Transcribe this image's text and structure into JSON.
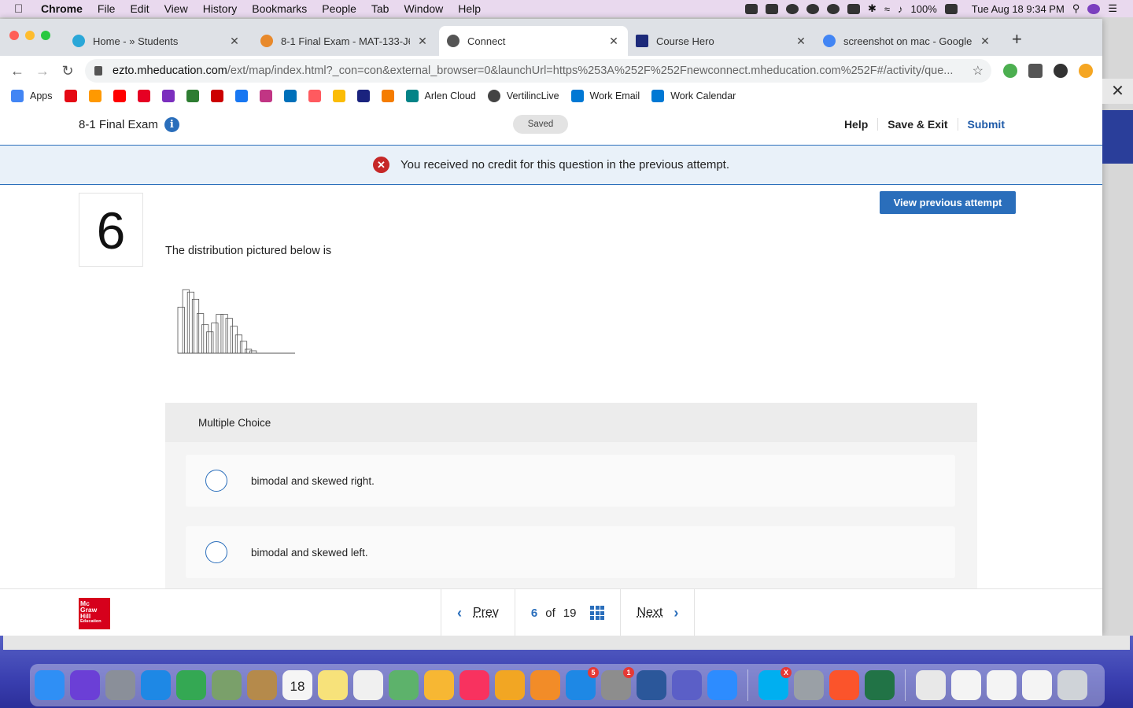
{
  "menubar": {
    "app": "Chrome",
    "items": [
      "File",
      "Edit",
      "View",
      "History",
      "Bookmarks",
      "People",
      "Tab",
      "Window",
      "Help"
    ],
    "battery": "100%",
    "clock": "Tue Aug 18  9:34 PM"
  },
  "browser": {
    "tabs": [
      {
        "label": "Home - » Students",
        "icon_color": "#2aa7d8"
      },
      {
        "label": "8-1 Final Exam - MAT-133-J68",
        "icon_color": "#e8892b"
      },
      {
        "label": "Connect",
        "icon_color": "#555555"
      },
      {
        "label": "Course Hero",
        "icon_color": "#1d2a7a"
      },
      {
        "label": "screenshot on mac - Google S",
        "icon_color": "#4285f4"
      }
    ],
    "url_host": "ezto.mheducation.com",
    "url_path": "/ext/map/index.html?_con=con&external_browser=0&launchUrl=https%253A%252F%252Fnewconnect.mheducation.com%252F#/activity/que...",
    "bookmarks": [
      {
        "label": "Apps",
        "color": "#4285f4"
      },
      {
        "label": "",
        "color": "#e50914"
      },
      {
        "label": "",
        "color": "#ff9900"
      },
      {
        "label": "",
        "color": "#ff0000"
      },
      {
        "label": "",
        "color": "#e60023"
      },
      {
        "label": "",
        "color": "#7b2fbe"
      },
      {
        "label": "",
        "color": "#2e7d32"
      },
      {
        "label": "",
        "color": "#cc0000"
      },
      {
        "label": "",
        "color": "#1877f2"
      },
      {
        "label": "",
        "color": "#c13584"
      },
      {
        "label": "",
        "color": "#0070ba"
      },
      {
        "label": "",
        "color": "#ff5a5f"
      },
      {
        "label": "",
        "color": "#fbbc05"
      },
      {
        "label": "",
        "color": "#1a237e"
      },
      {
        "label": "",
        "color": "#f57c00"
      },
      {
        "label": "Arlen Cloud",
        "color": "#038387"
      },
      {
        "label": "VertilincLive",
        "color": "#444444"
      },
      {
        "label": "Work Email",
        "color": "#0078d4"
      },
      {
        "label": "Work Calendar",
        "color": "#0078d4"
      }
    ]
  },
  "exam": {
    "title": "8-1 Final Exam",
    "saved": "Saved",
    "help": "Help",
    "save_exit": "Save & Exit",
    "submit": "Submit",
    "banner": "You received no credit for this question in the previous attempt.",
    "question_number": "6",
    "view_previous": "View previous attempt",
    "question_text": "The distribution pictured below is",
    "answer_type": "Multiple Choice",
    "options": [
      "bimodal and skewed right.",
      "bimodal and skewed left."
    ],
    "histogram_relative_heights": [
      0.58,
      0.8,
      0.77,
      0.68,
      0.5,
      0.36,
      0.27,
      0.38,
      0.49,
      0.49,
      0.44,
      0.34,
      0.23,
      0.15,
      0.05,
      0.03
    ]
  },
  "footer": {
    "logo_lines": [
      "Mc",
      "Graw",
      "Hill",
      "Education"
    ],
    "prev": "Prev",
    "current": "6",
    "of": "of",
    "total": "19",
    "next": "Next"
  },
  "dock": {
    "icons": [
      {
        "name": "finder",
        "color": "#2f8ff5"
      },
      {
        "name": "siri",
        "color": "#6b3fd6"
      },
      {
        "name": "launchpad",
        "color": "#8a8f99"
      },
      {
        "name": "safari",
        "color": "#1e88e5"
      },
      {
        "name": "chrome",
        "color": "#34a853"
      },
      {
        "name": "preview",
        "color": "#7aa06a"
      },
      {
        "name": "contacts",
        "color": "#b58a4b"
      },
      {
        "name": "calendar",
        "color": "#f5f5f5",
        "text": "18"
      },
      {
        "name": "notes",
        "color": "#f7e27a"
      },
      {
        "name": "reminders",
        "color": "#f0f0f0"
      },
      {
        "name": "maps",
        "color": "#5db26b"
      },
      {
        "name": "photos",
        "color": "#f7b733"
      },
      {
        "name": "music",
        "color": "#f8325f"
      },
      {
        "name": "keynote",
        "color": "#f2a623"
      },
      {
        "name": "books",
        "color": "#f28c28"
      },
      {
        "name": "app-store",
        "color": "#1e88e5",
        "badge": "5"
      },
      {
        "name": "system-preferences",
        "color": "#8d8d8d",
        "badge": "1"
      },
      {
        "name": "word",
        "color": "#2b579a"
      },
      {
        "name": "teams",
        "color": "#5b5fc7"
      },
      {
        "name": "zoom",
        "color": "#2d8cff"
      },
      {
        "name": "skype",
        "color": "#00aff0",
        "badge": "X"
      },
      {
        "name": "image-capture",
        "color": "#9aa0a6"
      },
      {
        "name": "brave",
        "color": "#fb542b"
      },
      {
        "name": "excel",
        "color": "#217346"
      },
      {
        "name": "download-stack",
        "color": "#e8e8e8"
      },
      {
        "name": "doc-stack-1",
        "color": "#f4f4f4"
      },
      {
        "name": "doc-stack-2",
        "color": "#f4f4f4"
      },
      {
        "name": "doc-stack-3",
        "color": "#f4f4f4"
      },
      {
        "name": "trash",
        "color": "#cfd3d8"
      }
    ]
  }
}
